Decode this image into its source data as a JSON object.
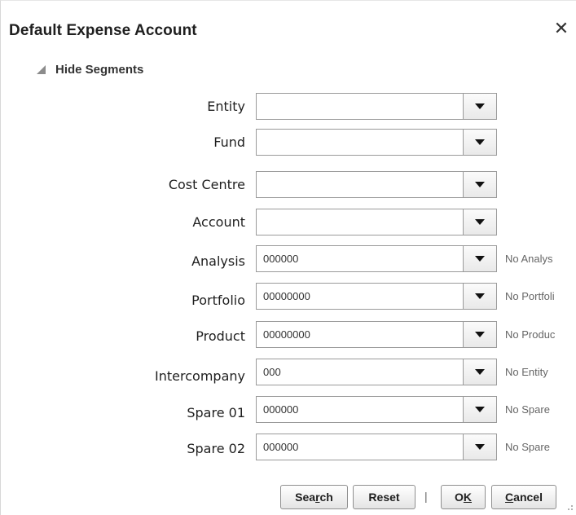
{
  "dialog": {
    "title": "Default Expense Account",
    "close_glyph": "✕",
    "disclosure_label": "Hide Segments"
  },
  "segments": [
    {
      "label": "Entity",
      "value": "",
      "description": ""
    },
    {
      "label": "Fund",
      "value": "",
      "description": ""
    },
    {
      "label": "Cost Centre",
      "value": "",
      "description": ""
    },
    {
      "label": "Account",
      "value": "",
      "description": ""
    },
    {
      "label": "Analysis",
      "value": "000000",
      "description": "No Analys"
    },
    {
      "label": "Portfolio",
      "value": "00000000",
      "description": "No Portfoli"
    },
    {
      "label": "Product",
      "value": "00000000",
      "description": "No Produc"
    },
    {
      "label": "Intercompany",
      "value": "000",
      "description": "No Entity"
    },
    {
      "label": "Spare 01",
      "value": "000000",
      "description": "No Spare"
    },
    {
      "label": "Spare 02",
      "value": "000000",
      "description": "No Spare"
    }
  ],
  "buttons": {
    "search": {
      "pre": "Sea",
      "accel": "r",
      "post": "ch"
    },
    "reset": "Reset",
    "separator": "|",
    "ok": {
      "pre": "O",
      "accel": "K",
      "post": ""
    },
    "cancel": {
      "pre": "",
      "accel": "C",
      "post": "ancel"
    }
  },
  "icons": {
    "close": "close-icon",
    "disclosure": "triangle-expanded-icon",
    "dropdown": "chevron-down-icon",
    "resize": "resize-grip-icon"
  }
}
